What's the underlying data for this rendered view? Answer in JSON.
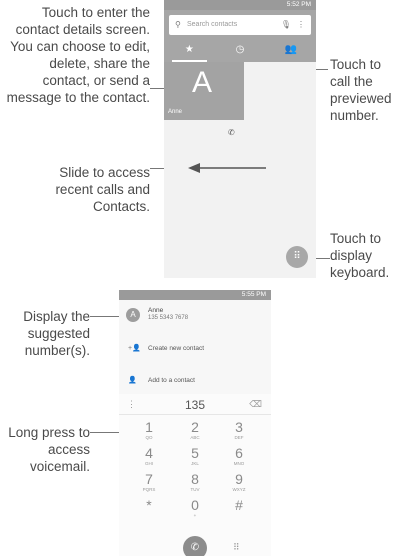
{
  "callouts": {
    "contact_details": "Touch to enter the contact details screen. You can choose to edit, delete, share the contact, or send a message to the contact.",
    "call_previewed": "Touch to call the previewed number.",
    "slide": "Slide to access recent calls and Contacts.",
    "display_keyboard": "Touch to display keyboard.",
    "suggested": "Display the suggested number(s).",
    "long_press": "Long press to access voicemail."
  },
  "phone1": {
    "status_time": "5:52 PM",
    "search_placeholder": "Search contacts",
    "tabs": [
      "★",
      "◷",
      "👥"
    ],
    "contact_initial": "A",
    "contact_name": "Anne",
    "icons": {
      "search": "search-icon",
      "mic": "mic-icon",
      "more": "more-vert-icon",
      "call": "phone-icon",
      "dialpad": "dialpad-icon"
    }
  },
  "phone2": {
    "status_time": "5:55 PM",
    "suggestion": {
      "initial": "A",
      "name": "Anne",
      "number": "135 5343 7678"
    },
    "create_new": "Create new contact",
    "add_to": "Add to a contact",
    "dialed": "135",
    "keys": [
      {
        "d": "1",
        "l": "QO"
      },
      {
        "d": "2",
        "l": "ABC"
      },
      {
        "d": "3",
        "l": "DEF"
      },
      {
        "d": "4",
        "l": "GHI"
      },
      {
        "d": "5",
        "l": "JKL"
      },
      {
        "d": "6",
        "l": "MNO"
      },
      {
        "d": "7",
        "l": "PQRS"
      },
      {
        "d": "8",
        "l": "TUV"
      },
      {
        "d": "9",
        "l": "WXYZ"
      },
      {
        "d": "*",
        "l": ""
      },
      {
        "d": "0",
        "l": "+"
      },
      {
        "d": "#",
        "l": ""
      }
    ]
  }
}
